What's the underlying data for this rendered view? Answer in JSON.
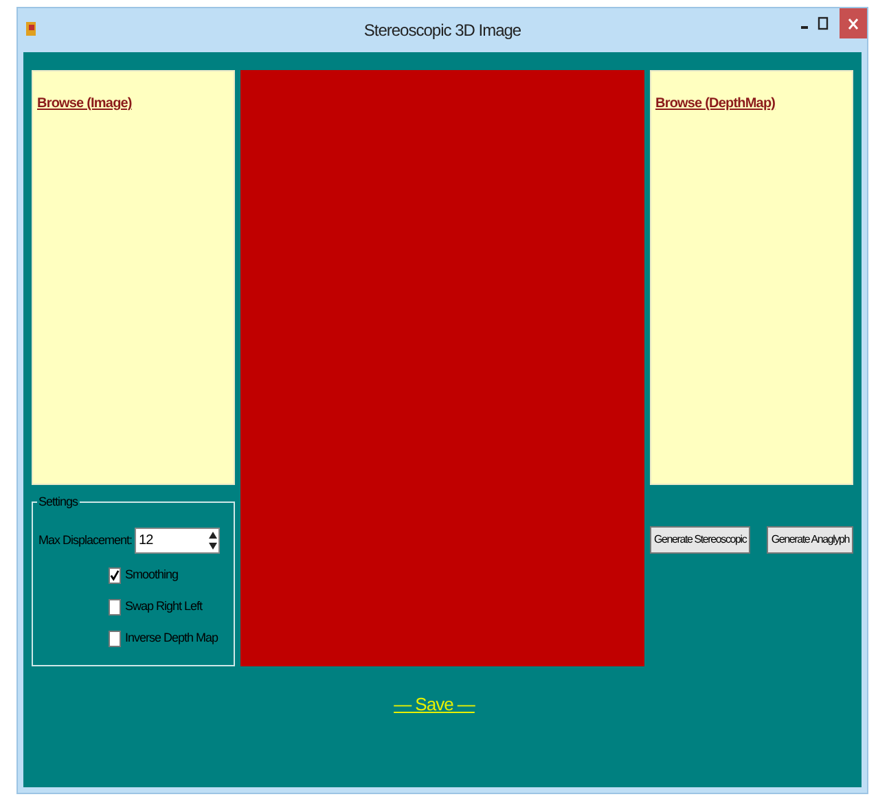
{
  "window": {
    "title": "Stereoscopic 3D Image"
  },
  "image_panel": {
    "link": "Browse (Image)"
  },
  "depth_panel": {
    "link": "Browse (DepthMap)"
  },
  "settings": {
    "title": "Settings",
    "max_displacement": {
      "label": "Max Displacement:",
      "value": "12"
    },
    "options": [
      {
        "label": "Smoothing",
        "checked": true
      },
      {
        "label": "Swap Right Left",
        "checked": false
      },
      {
        "label": "Inverse Depth Map",
        "checked": false
      }
    ]
  },
  "buttons": [
    "Generate Stereoscopic",
    "Generate Anaglyph"
  ],
  "save_link": "— Save —"
}
